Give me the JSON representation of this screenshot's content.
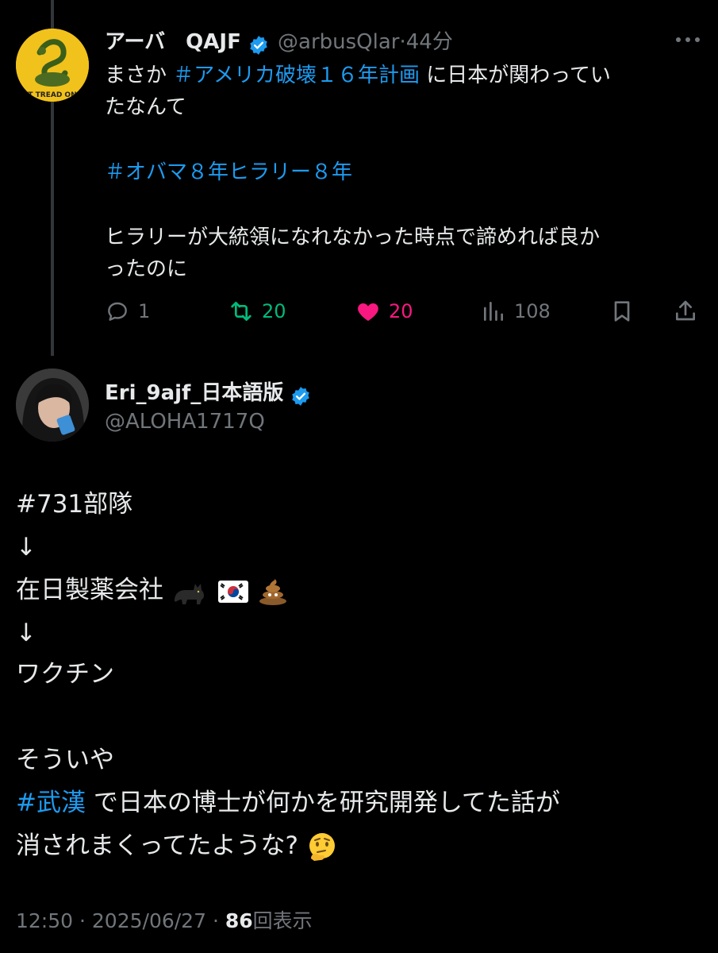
{
  "first_tweet": {
    "display_name": "アーバ　QAJF",
    "handle": "@arbusQlar",
    "separator": "·",
    "time_ago": "44分",
    "text_line1_prefix": "まさか ",
    "hashtag1": "＃アメリカ破壊１６年計画",
    "text_line1_suffix": " に日本が関わってい",
    "text_line2": "たなんて",
    "hashtag2": "＃オバマ８年ヒラリー８年",
    "text_line3": "ヒラリーが大統領になれなかった時点で諦めれば良か",
    "text_line4": "ったのに",
    "avatar_text": "T TREAD ON",
    "stats": {
      "replies": "1",
      "reposts": "20",
      "likes": "20",
      "views": "108"
    },
    "colors": {
      "repost": "#00ba7c",
      "like": "#f91880"
    }
  },
  "main_tweet": {
    "display_name": "Eri_9ajf_日本語版",
    "handle": "@ALOHA1717Q",
    "hashtag1": "#731部隊",
    "arrow": "↓",
    "line_company": "在日製薬会社",
    "line_vaccine": "ワクチン",
    "line_souiya": "そういや",
    "hashtag2": "#武漢",
    "line_wuhan_suffix": " で日本の博士が何かを研究開発してた話が",
    "line_last": "消されまくってたような?"
  },
  "footer": {
    "time": "12:50",
    "separator": "·",
    "date": "2025/06/27",
    "views_count": "86",
    "views_label": "回表示"
  },
  "colors": {
    "background": "#000000",
    "text": "#e7e9ea",
    "muted": "#71767b",
    "link": "#1d9bf0",
    "verified": "#1d9bf0"
  }
}
